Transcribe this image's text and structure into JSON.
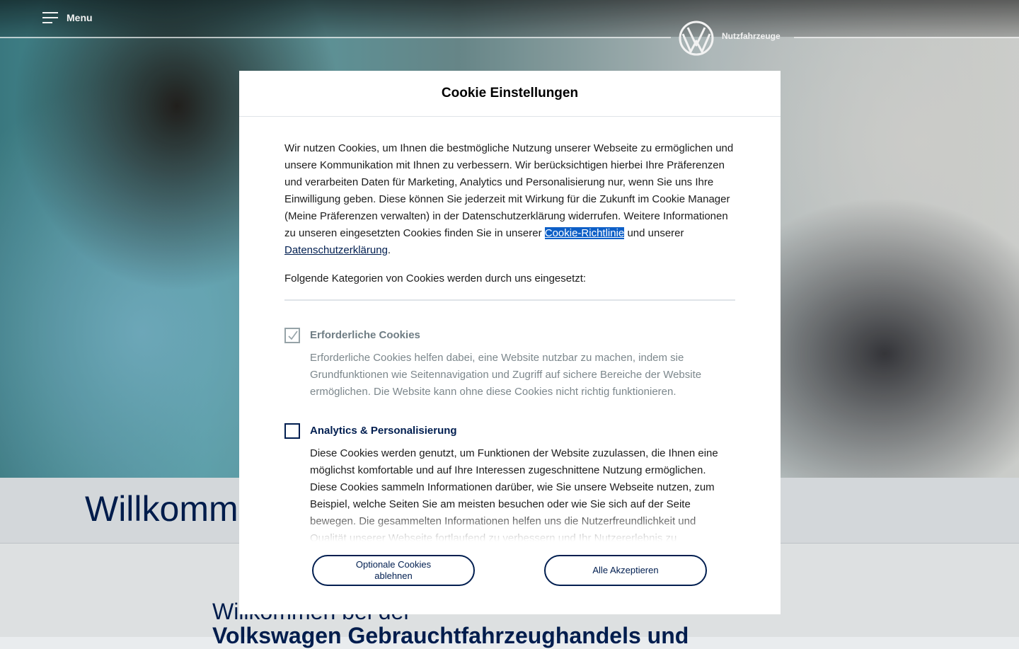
{
  "header": {
    "menu_label": "Menu",
    "brand_label": "Nutzfahrzeuge",
    "logo_icon": "vw-logo-icon"
  },
  "page": {
    "welcome_title": "Willkommen",
    "sub_line1": "Willkommen bei der",
    "sub_line2": "Volkswagen Gebrauchtfahrzeughandels und"
  },
  "cookie_dialog": {
    "title": "Cookie Einstellungen",
    "intro_text": "Wir nutzen Cookies, um Ihnen die bestmögliche Nutzung unserer Webseite zu ermöglichen und unsere Kommunikation mit Ihnen zu verbessern. Wir berücksichtigen hierbei Ihre Präferenzen und verarbeiten Daten für Marketing, Analytics und Personalisierung nur, wenn Sie uns Ihre Einwilligung geben. Diese können Sie jederzeit mit Wirkung für die Zukunft im Cookie Manager (Meine Präferenzen verwalten) in der Datenschutzerklärung widerrufen. Weitere Informationen zu unseren eingesetzten Cookies finden Sie in unserer",
    "cookie_link": "Cookie-Richtlinie",
    "and_text": "und unserer",
    "privacy_link": "Datenschutzerklärung",
    "period": ".",
    "categories_intro": "Folgende Kategorien von Cookies werden durch uns eingesetzt:",
    "categories": [
      {
        "title": "Erforderliche Cookies",
        "checked": true,
        "disabled": true,
        "description": "Erforderliche Cookies helfen dabei, eine Website nutzbar zu machen, indem sie Grundfunktionen wie Seitennavigation und Zugriff auf sichere Bereiche der Website ermöglichen. Die Website kann ohne diese Cookies nicht richtig funktionieren."
      },
      {
        "title": "Analytics & Personalisierung",
        "checked": false,
        "disabled": false,
        "description": "Diese Cookies werden genutzt, um Funktionen der Website zuzulassen, die Ihnen eine möglichst komfortable und auf Ihre Interessen zugeschnittene Nutzung ermöglichen. Diese Cookies sammeln Informationen darüber, wie Sie unsere Webseite nutzen, zum Beispiel, welche Seiten Sie am meisten besuchen oder wie Sie sich auf der Seite bewegen. Die gesammelten Informationen helfen uns die Nutzerfreundlichkeit und Qualität unserer Webseite fortlaufend zu verbessern und Ihr Nutzererlebnis zu"
      }
    ],
    "decline_button": "Optionale Cookies ablehnen",
    "accept_button": "Alle Akzeptieren"
  },
  "colors": {
    "brand_navy": "#001e50",
    "link_highlight": "#0d5fc7"
  }
}
